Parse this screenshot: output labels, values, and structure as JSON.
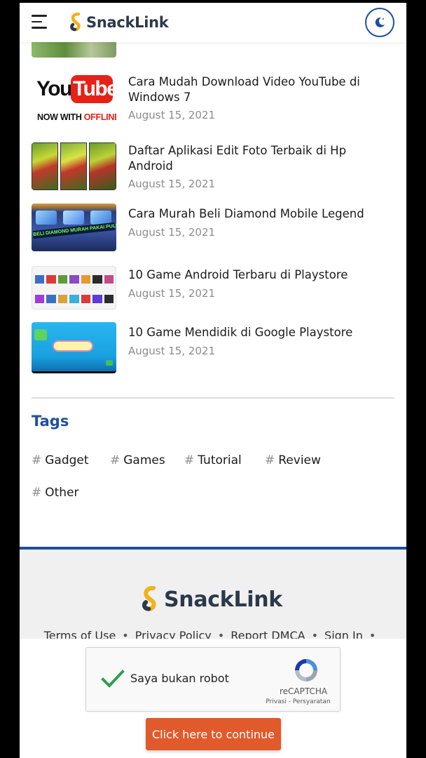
{
  "header": {
    "brand": "SnackLink",
    "menu_icon": "hamburger-menu-icon",
    "theme_icon": "moon-icon"
  },
  "posts": [
    {
      "title": "Cara Mudah Download Video YouTube di Windows 7",
      "date": "August 15, 2021",
      "thumb_text_top": "YouTube",
      "thumb_text_bottom_1": "NOW WITH ",
      "thumb_text_bottom_2": "OFFLINE"
    },
    {
      "title": "Daftar Aplikasi Edit Foto Terbaik di Hp Android",
      "date": "August 15, 2021"
    },
    {
      "title": "Cara Murah Beli Diamond Mobile Legend",
      "date": "August 15, 2021",
      "thumb_text": "BELI DIAMOND MURAH PAKAI PULSA"
    },
    {
      "title": "10 Game Android Terbaru di Playstore",
      "date": "August 15, 2021"
    },
    {
      "title": "10 Game Mendidik di Google Playstore",
      "date": "August 15, 2021"
    }
  ],
  "tags": {
    "title": "Tags",
    "items": [
      "Gadget",
      "Games",
      "Tutorial",
      "Review",
      "Other"
    ],
    "hash": "#"
  },
  "footer": {
    "brand": "SnackLink",
    "links": [
      "Terms of Use",
      "Privacy Policy",
      "Report DMCA",
      "Sign In"
    ],
    "separator": "•"
  },
  "captcha": {
    "label": "Saya bukan robot",
    "brand": "reCAPTCHA",
    "links": "Privasi - Persyaratan"
  },
  "continue_button": "Click here to continue",
  "colors": {
    "accent_blue": "#1f4f9e",
    "brand_gold": "#f2b21c",
    "brand_text": "#2b3a4a",
    "button_orange": "#e05a2b",
    "check_green": "#2e9e4f"
  }
}
